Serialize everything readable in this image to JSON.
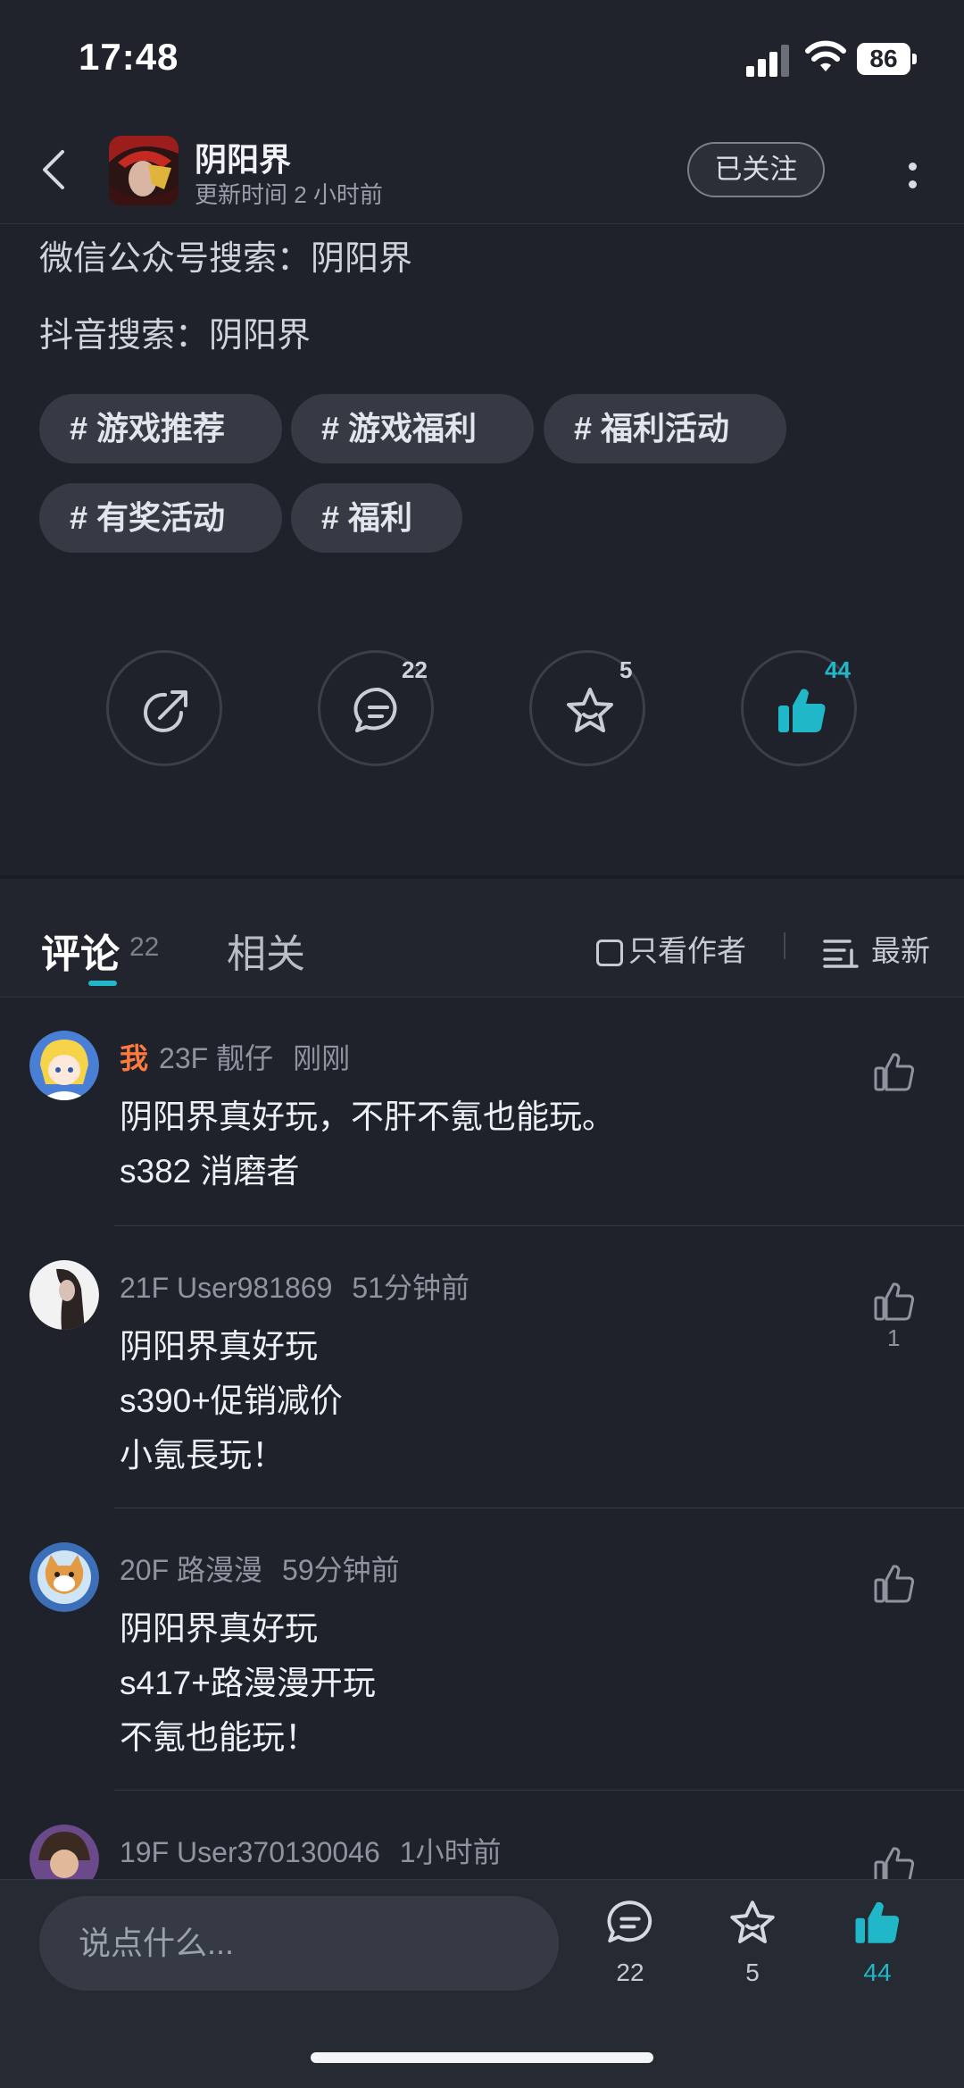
{
  "status_bar": {
    "time": "17:48",
    "battery": "86"
  },
  "header": {
    "title": "阴阳界",
    "subtitle": "更新时间 2 小时前",
    "follow_label": "已关注"
  },
  "content": {
    "lines": [
      "微信公众号搜索：阴阳界",
      "抖音搜索：阴阳界"
    ],
    "tags": [
      "# 游戏推荐",
      "# 游戏福利",
      "# 福利活动",
      "# 有奖活动",
      "# 福利"
    ]
  },
  "actions": {
    "share_icon": "share-icon",
    "comments_count": "22",
    "favorites_count": "5",
    "likes_count": "44",
    "accent": "#20b8c8"
  },
  "tabs": {
    "comment_label": "评论",
    "comment_count": "22",
    "related_label": "相关",
    "author_only_label": "只看作者",
    "sort_label": "最新"
  },
  "comments": [
    {
      "is_me": "我",
      "floor_user": "23F 靓仔",
      "time": "刚刚",
      "lines": [
        "阴阳界真好玩，不肝不氪也能玩。",
        "s382 消磨者"
      ],
      "likes": ""
    },
    {
      "floor_user": "21F User981869",
      "time": "51分钟前",
      "lines": [
        "阴阳界真好玩",
        "s390+促销减价",
        "小氪長玩！"
      ],
      "likes": "1"
    },
    {
      "floor_user": "20F 路漫漫",
      "time": "59分钟前",
      "lines": [
        "阴阳界真好玩",
        "s417+路漫漫开玩",
        "不氪也能玩！"
      ],
      "likes": ""
    },
    {
      "floor_user": "19F User370130046",
      "time": "1小时前",
      "lines": [],
      "likes": ""
    }
  ],
  "bottom_bar": {
    "input_placeholder": "说点什么...",
    "comments_count": "22",
    "favorites_count": "5",
    "likes_count": "44"
  }
}
